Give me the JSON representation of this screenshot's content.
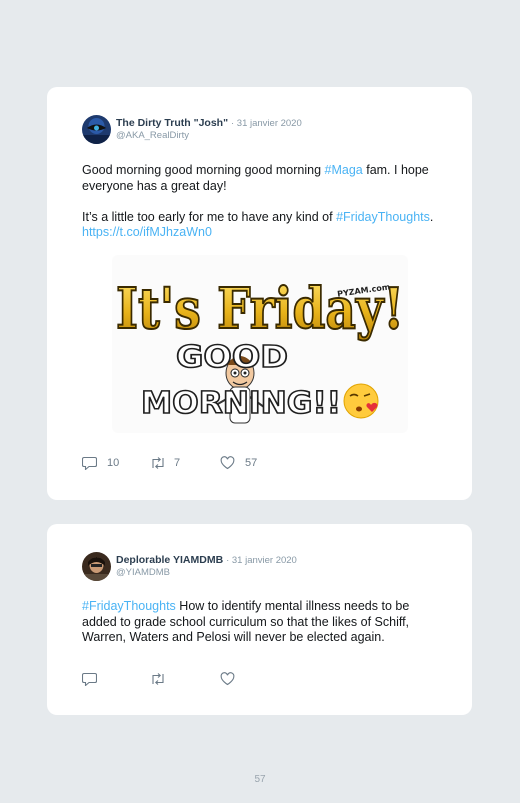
{
  "tweets": [
    {
      "author_name": "The Dirty Truth \"Josh\"",
      "date": "· 31 janvier 2020",
      "handle": "@AKA_RealDirty",
      "text_p1_pre": "Good morning good morning good morning ",
      "text_p1_hashtag": "#Maga",
      "text_p1_post": " fam. I hope everyone has a great day!",
      "text_p2_pre": "It’s a little too early for me to have any kind of ",
      "text_p2_hashtag": "#FridayThoughts",
      "text_p2_mid": ". ",
      "text_p2_link": "https://t.co/ifMJhzaWn0",
      "image": {
        "line1": "It's Friday!",
        "line2": "GOOD",
        "line3": "MORNING!!",
        "watermark": "PYZAM.com"
      },
      "replies": "10",
      "retweets": "7",
      "likes": "57"
    },
    {
      "author_name": "Deplorable YIAMDMB",
      "date": "· 31 janvier 2020",
      "handle": "@YIAMDMB",
      "text_hashtag": "#FridayThoughts",
      "text_post": " How to identify mental illness needs to be added to grade school curriculum so that the likes of Schiff, Warren, Waters and Pelosi will never be elected again."
    }
  ],
  "page_number": "57",
  "colors": {
    "background": "#e6eaed",
    "card": "#ffffff",
    "link": "#4ab3f4",
    "name": "#2c3e50",
    "muted": "#8899a6"
  },
  "icons": [
    "reply-icon",
    "retweet-icon",
    "like-icon"
  ]
}
